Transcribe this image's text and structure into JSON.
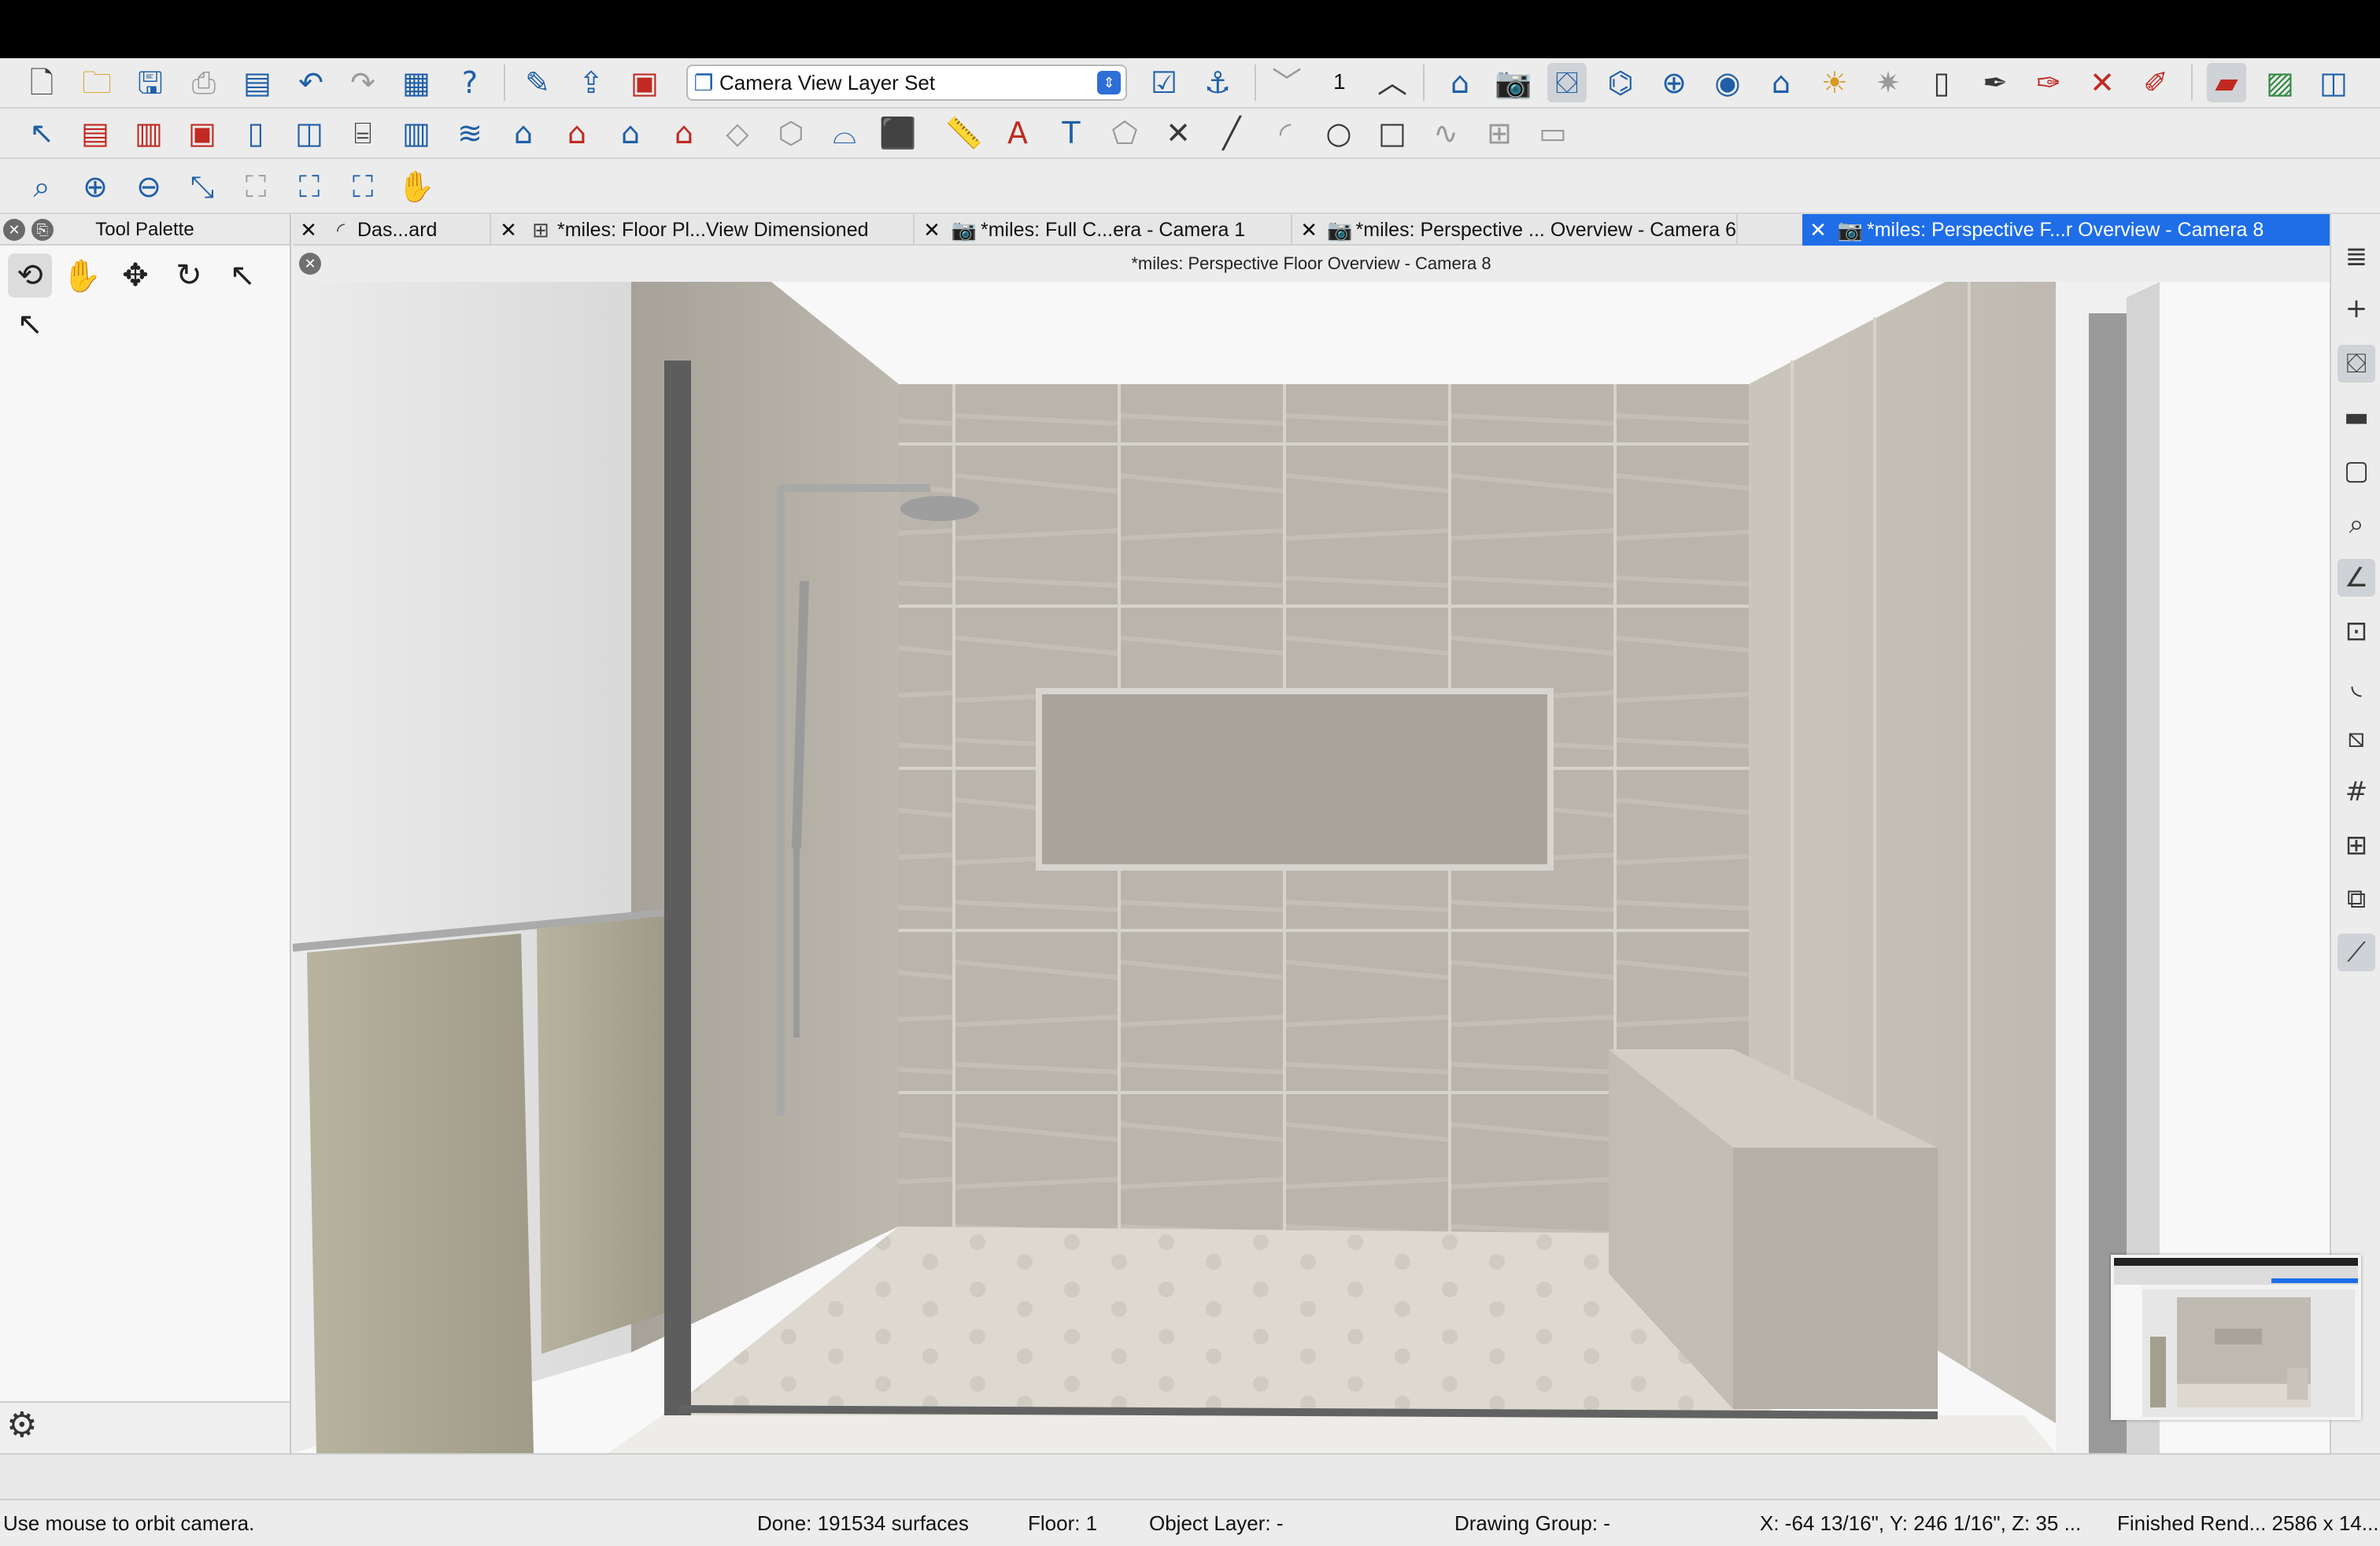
{
  "toolbar_top": {
    "layer_set": "Camera View Layer Set",
    "floor_number": "1",
    "icons": [
      "new-file-icon",
      "open-folder-icon",
      "save-icon",
      "print-icon",
      "print-preview-icon",
      "undo-icon",
      "redo-icon",
      "layout-icon",
      "help-icon",
      "edit-icon",
      "export-icon",
      "save-as-icon",
      "checklist-icon",
      "anchor-icon",
      "floor-down-icon",
      "floor-up-icon",
      "house-icon",
      "camera-icon",
      "camera-settings-icon",
      "elevation-icon",
      "walkthrough-icon",
      "camera-orbit-icon",
      "home-icon",
      "light-icon",
      "sun-icon",
      "rooms-icon",
      "eyedropper-icon",
      "material-painter-icon",
      "delete-materials-icon",
      "pencil-icon",
      "layer-display-icon",
      "image-icon",
      "split-view-icon"
    ]
  },
  "toolbar_mid": {
    "icons": [
      "select-icon",
      "wall-icon",
      "railing-icon",
      "cabinet-icon",
      "door-icon",
      "window-icon",
      "stair-icon",
      "column-icon",
      "framing-icon",
      "roof-icon",
      "gable-icon",
      "dormer-icon",
      "ceiling-icon",
      "floor-icon",
      "slab-icon",
      "molding-icon",
      "box-icon",
      "ruler-icon",
      "dimension-icon",
      "text-icon",
      "shape-icon",
      "delete-line-icon",
      "line-icon",
      "arc-icon",
      "circle-icon",
      "rectangle-icon",
      "spline-icon",
      "library-icon",
      "cad-icon"
    ]
  },
  "toolbar_zoom": {
    "icons": [
      "zoom-box-icon",
      "zoom-in-icon",
      "zoom-out-icon",
      "undo-zoom-icon",
      "fill-window-icon",
      "fill-window-content-icon",
      "fit-icon",
      "pan-icon"
    ]
  },
  "palette": {
    "title": "Tool Palette",
    "tools": [
      "camera-orbit-tool-icon",
      "pan-tool-icon",
      "move-tool-icon",
      "rotate-tool-icon",
      "select-tool-icon",
      "cursor-tool-icon"
    ]
  },
  "tabs": [
    {
      "label": "Das...ard",
      "icon": "dashboard-icon",
      "active": false
    },
    {
      "label": "*miles: Floor Pl...View Dimensioned",
      "icon": "floor-plan-icon",
      "active": false
    },
    {
      "label": "*miles: Full C...era - Camera 1",
      "icon": "camera-icon",
      "active": false
    },
    {
      "label": "*miles: Perspective ... Overview - Camera 6",
      "icon": "camera-icon",
      "active": false
    },
    {
      "label": "*miles: Perspective F...r Overview - Camera 8",
      "icon": "camera-icon",
      "active": true
    }
  ],
  "view_title": "*miles: Perspective Floor Overview - Camera 8",
  "rightbar": {
    "icons": [
      "layer-icon",
      "add-icon",
      "material-icon",
      "wall-type-icon",
      "page-icon",
      "zoom-page-icon",
      "angle-icon",
      "edit-area-icon",
      "curve-icon",
      "terrain-icon",
      "grid-icon",
      "grid-check-icon",
      "transform-icon",
      "plot-icon"
    ]
  },
  "status": {
    "hint": "Use mouse to orbit camera.",
    "done": "Done:  191534 surfaces",
    "floor": "Floor: 1",
    "object_layer": "Object Layer: -",
    "drawing_group": "Drawing Group: -",
    "coords": "X: -64 13/16\", Y: 246 1/16\", Z: 35 ...",
    "render": "Finished Rend...  2586 x 14..."
  },
  "colors": {
    "active_tab": "#1f6ee8",
    "tile": "#b8b4ab",
    "floor_tile": "#ddd9d0"
  }
}
